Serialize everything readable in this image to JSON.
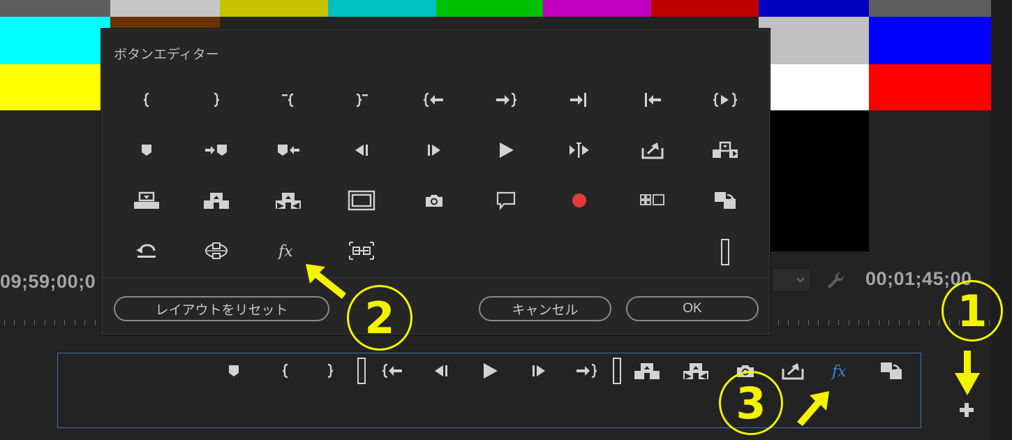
{
  "colors": {
    "background": "#232323",
    "dialog_bg": "#262626",
    "icon": "#d2d2d2",
    "fx_active": "#3d86d8",
    "record": "#e23b3b",
    "toolbar_border": "#3b73b8",
    "annotation": "#f3f300"
  },
  "monitor": {
    "timecode_left": "09;59;00;0",
    "timecode_right": "00;01;45;00"
  },
  "dialog": {
    "title": "ボタンエディター",
    "icons": [
      "mark-in-icon",
      "mark-out-icon",
      "clear-in-icon",
      "clear-out-icon",
      "go-to-in-icon",
      "go-to-out-icon",
      "go-to-next-edit-icon",
      "go-to-previous-edit-icon",
      "play-in-to-out-icon",
      "add-marker-icon",
      "go-to-next-marker-icon",
      "go-to-previous-marker-icon",
      "step-back-icon",
      "step-forward-icon",
      "play-icon",
      "play-around-icon",
      "lift-icon",
      "extract-icon",
      "insert-icon",
      "overwrite-icon",
      "replace-icon",
      "safe-margins-icon",
      "export-frame-icon",
      "closed-captions-icon",
      "record-icon",
      "multi-camera-icon",
      "toggle-proxies-icon",
      "loop-icon",
      "vr-video-icon",
      "global-fx-mute-icon",
      "comparison-view-icon",
      "spacer-icon"
    ],
    "reset_label": "レイアウトをリセット",
    "cancel_label": "キャンセル",
    "ok_label": "OK"
  },
  "toolbar": {
    "icons": [
      "add-marker-icon",
      "mark-in-icon",
      "mark-out-icon",
      "spacer-icon",
      "go-to-in-icon",
      "step-back-icon",
      "play-icon",
      "step-forward-icon",
      "go-to-out-icon",
      "spacer-icon",
      "overwrite-icon",
      "replace-icon",
      "export-frame-icon",
      "lift-icon",
      "global-fx-mute-icon",
      "toggle-proxies-icon"
    ],
    "add_button": "plus-icon"
  },
  "annotations": {
    "labels": [
      "1",
      "2",
      "3"
    ]
  }
}
